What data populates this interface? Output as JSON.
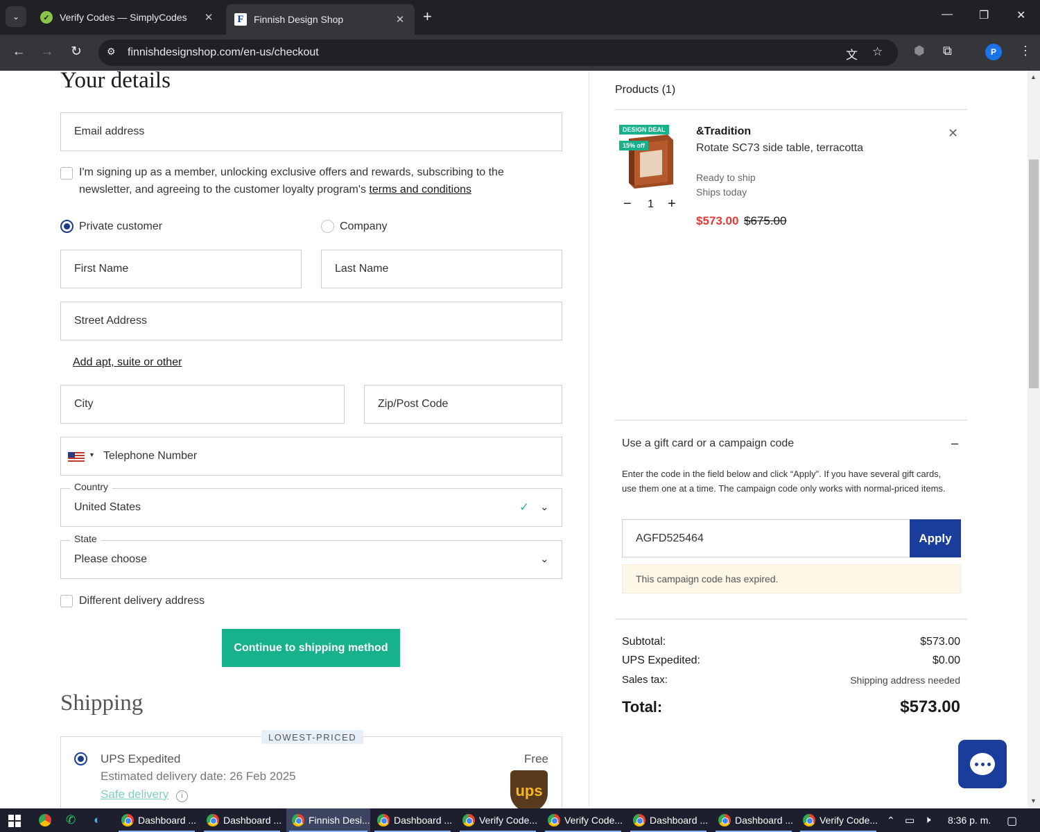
{
  "browser": {
    "tabs": [
      {
        "title": "Verify Codes — SimplyCodes",
        "close": "✕"
      },
      {
        "title": "Finnish Design Shop",
        "close": "✕"
      }
    ],
    "url": "finnishdesignshop.com/en-us/checkout",
    "profile_initial": "P"
  },
  "details": {
    "heading": "Your details",
    "email_placeholder": "Email address",
    "member_text": "I'm signing up as a member, unlocking exclusive offers and rewards, subscribing to the newsletter, and agreeing to the customer loyalty program's",
    "member_link": "terms and conditions",
    "customer_types": [
      "Private customer",
      "Company"
    ],
    "selected_customer_type": "Private customer",
    "first_name_placeholder": "First Name",
    "last_name_placeholder": "Last Name",
    "street_placeholder": "Street Address",
    "add_apt_link": "Add apt, suite or other",
    "city_placeholder": "City",
    "zip_placeholder": "Zip/Post Code",
    "phone_placeholder": "Telephone Number",
    "country_label": "Country",
    "country_value": "United States",
    "state_label": "State",
    "state_value": "Please choose",
    "different_delivery": "Different delivery address",
    "continue_button": "Continue to shipping method"
  },
  "shipping": {
    "heading": "Shipping",
    "badge": "LOWEST-PRICED",
    "method": "UPS Expedited",
    "price": "Free",
    "estimate": "Estimated delivery date: 26 Feb 2025",
    "safe_delivery": "Safe delivery",
    "carrier_logo": "ups"
  },
  "cart": {
    "products_title": "Products (1)",
    "product": {
      "badge_deal": "DESIGN DEAL",
      "badge_off": "15% off",
      "brand": "&Tradition",
      "name": "Rotate SC73 side table, terracotta",
      "availability": "Ready to ship",
      "ships": "Ships today",
      "quantity": "1",
      "price": "$573.00",
      "old_price": "$675.00"
    },
    "gift": {
      "title": "Use a gift card or a campaign code",
      "toggle": "–",
      "instructions": "Enter the code in the field below and click “Apply”. If you have several gift cards, use them one at a time. The campaign code only works with normal-priced items.",
      "code_value": "AGFD525464",
      "apply": "Apply",
      "error": "This campaign code has expired."
    },
    "summary": {
      "subtotal_label": "Subtotal:",
      "subtotal_value": "$573.00",
      "shipping_label": "UPS Expedited:",
      "shipping_value": "$0.00",
      "tax_label": "Sales tax:",
      "tax_value": "Shipping address needed",
      "total_label": "Total:",
      "total_value": "$573.00"
    }
  },
  "colors": {
    "accent_green": "#17b18b",
    "brand_blue": "#1a3c9b",
    "sale_red": "#e53935"
  },
  "taskbar": {
    "items": [
      "Dashboard ...",
      "Dashboard ...",
      "Finnish Desi...",
      "Dashboard ...",
      "Verify Code...",
      "Verify Code...",
      "Dashboard ...",
      "Dashboard ...",
      "Verify Code..."
    ],
    "clock": "8:36 p. m."
  }
}
